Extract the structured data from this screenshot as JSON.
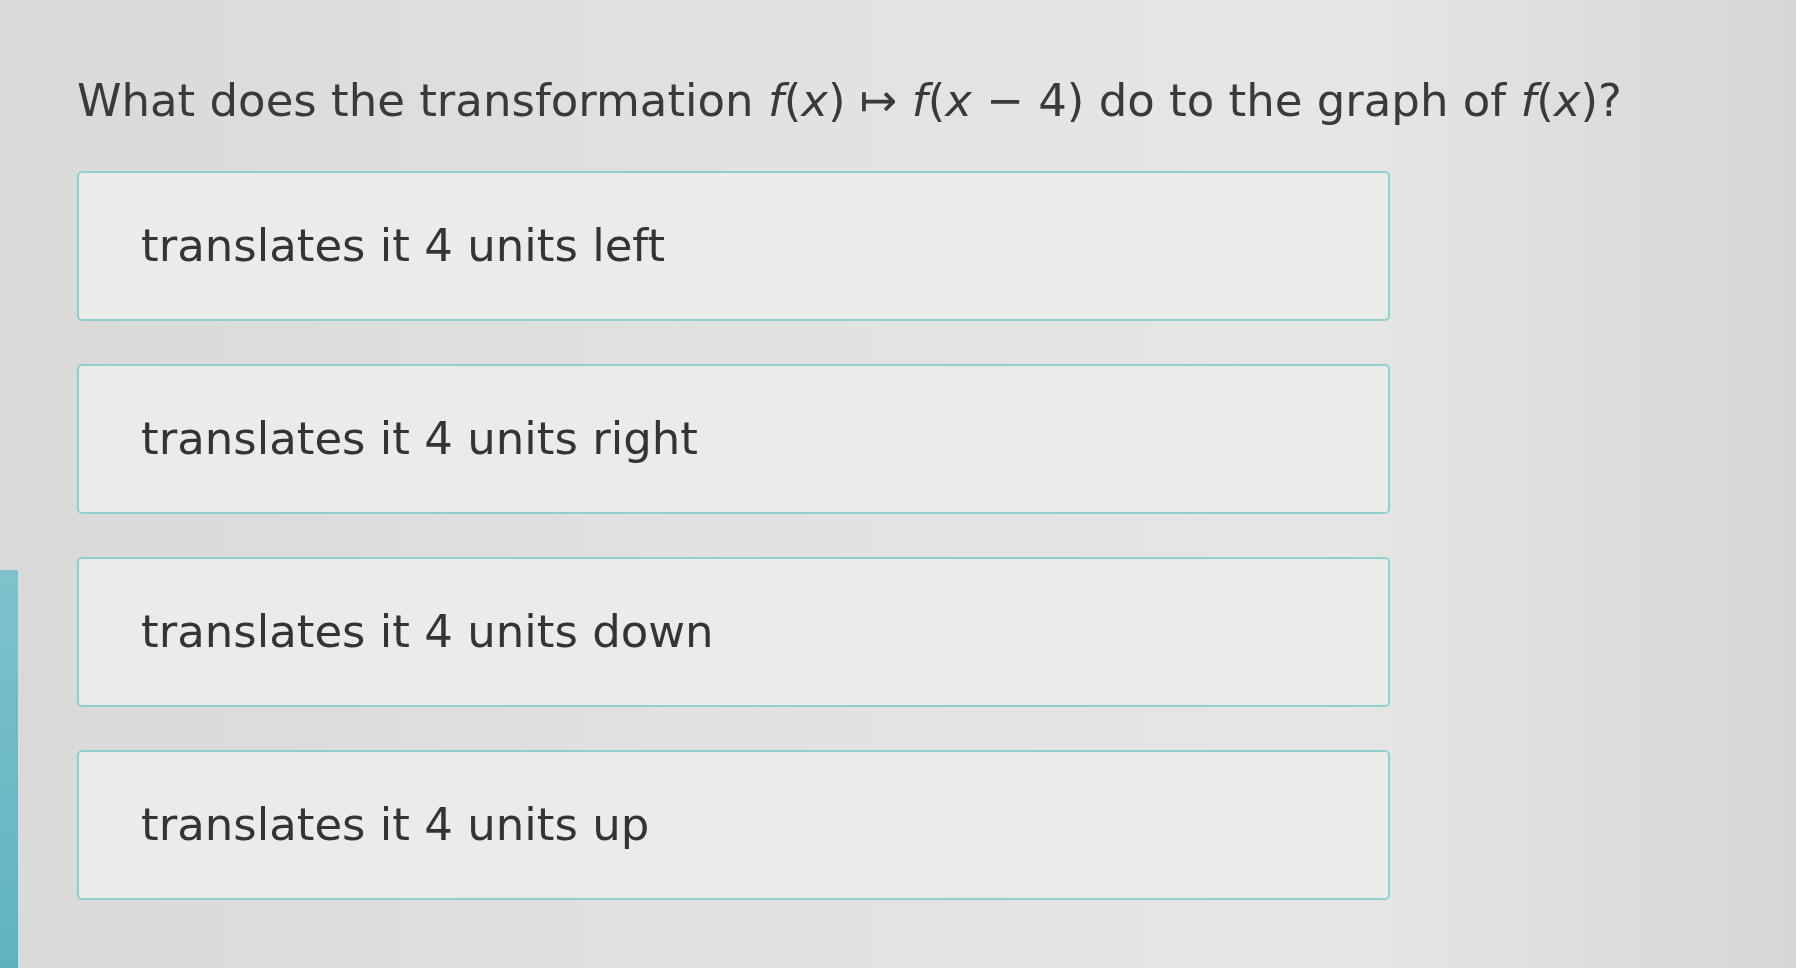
{
  "question": {
    "text": "What does the transformation *f*(*x*) ↦ *f*(*x* − 4) do to the graph of *f*(*x*)?"
  },
  "options": [
    {
      "label": "translates it 4 units left"
    },
    {
      "label": "translates it 4 units right"
    },
    {
      "label": "translates it 4 units down"
    },
    {
      "label": "translates it 4 units up"
    }
  ]
}
